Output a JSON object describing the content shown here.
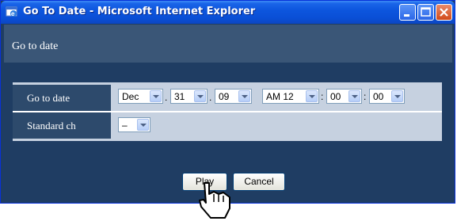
{
  "window": {
    "title": "Go To Date - Microsoft Internet Explorer"
  },
  "header": {
    "title": "Go to date"
  },
  "form": {
    "rows": [
      {
        "label": "Go to date"
      },
      {
        "label": "Standard ch"
      }
    ],
    "date": {
      "month": "Dec",
      "day": "31",
      "year": "09",
      "hour": "AM 12",
      "minute": "00",
      "second": "00",
      "date_sep_1": ".",
      "date_sep_2": ".",
      "time_sep_1": ":",
      "time_sep_2": ":"
    },
    "channel": {
      "value": "–"
    }
  },
  "buttons": {
    "play": "Play",
    "cancel": "Cancel"
  }
}
